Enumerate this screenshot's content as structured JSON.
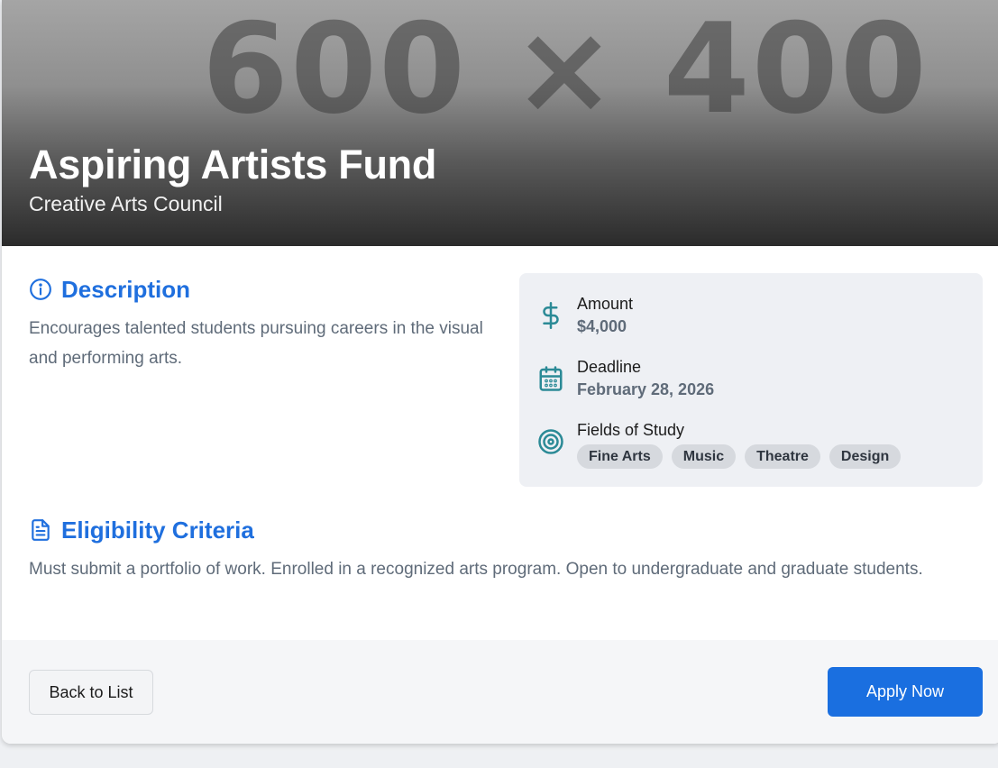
{
  "hero": {
    "placeholder": "600 × 400",
    "title": "Aspiring Artists Fund",
    "subtitle": "Creative Arts Council"
  },
  "description": {
    "heading": "Description",
    "icon": "info-icon",
    "text": "Encourages talented students pursuing careers in the visual and performing arts."
  },
  "eligibility": {
    "heading": "Eligibility Criteria",
    "icon": "document-icon",
    "text": "Must submit a portfolio of work. Enrolled in a recognized arts program. Open to undergraduate and graduate students."
  },
  "details": {
    "amount": {
      "label": "Amount",
      "value": "$4,000",
      "icon": "dollar-icon"
    },
    "deadline": {
      "label": "Deadline",
      "value": "February 28, 2026",
      "icon": "calendar-icon"
    },
    "fields": {
      "label": "Fields of Study",
      "icon": "target-icon",
      "tags": [
        "Fine Arts",
        "Music",
        "Theatre",
        "Design"
      ]
    }
  },
  "actions": {
    "back_label": "Back to List",
    "apply_label": "Apply Now"
  },
  "colors": {
    "accent": "#1a6fe0",
    "icon_teal": "#2b8a96",
    "heading_blue": "#1f6fde"
  }
}
